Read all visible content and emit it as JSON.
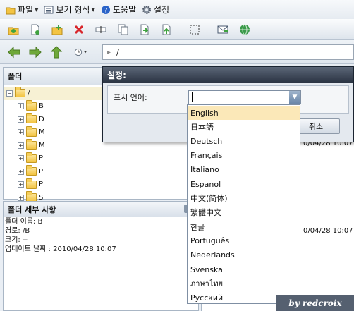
{
  "menubar": {
    "items": [
      {
        "label": "파일",
        "icon": "folder-icon",
        "has_caret": true
      },
      {
        "label": "보기 형식",
        "icon": "view-icon",
        "has_caret": true
      },
      {
        "label": "도움말",
        "icon": "help-icon",
        "has_caret": false
      },
      {
        "label": "설정",
        "icon": "gear-icon",
        "has_caret": false
      }
    ]
  },
  "toolbar": {
    "icons": [
      "new-folder-icon",
      "new-file-icon",
      "add-folder-icon",
      "delete-icon",
      "rename-icon",
      "copy-icon",
      "move-icon",
      "upload-icon",
      "select-icon",
      "email-icon",
      "web-icon"
    ]
  },
  "navbar": {
    "address": "/"
  },
  "folder_panel": {
    "title": "폴더",
    "root": "/",
    "children": [
      "B",
      "D",
      "M",
      "M",
      "P",
      "P",
      "P",
      "S"
    ]
  },
  "detail_panel": {
    "title": "폴더 세부 사항",
    "rows": [
      "폴더 이름: B",
      "경로: /B",
      "크기: --",
      "업데이트 날짜 : 2010/04/28 10:07"
    ]
  },
  "file_area": {
    "dates": [
      "0/04/28 10:07",
      "0/04/28 10:07"
    ]
  },
  "dialog": {
    "title": "설정:",
    "language_label": "표시 언어:",
    "cancel_label": "취소"
  },
  "language_list": {
    "selected_index": 0,
    "items": [
      "English",
      "日本語",
      "Deutsch",
      "Français",
      "Italiano",
      "Espanol",
      "中文(简体)",
      "繁體中文",
      "한글",
      "Português",
      "Nederlands",
      "Svenska",
      "ภาษาไทย",
      "Русский"
    ]
  },
  "watermark": "by redcroix",
  "colors": {
    "dialog_title": "#2b3443",
    "selection": "#fbe8b8",
    "folder": "#f3c443"
  }
}
